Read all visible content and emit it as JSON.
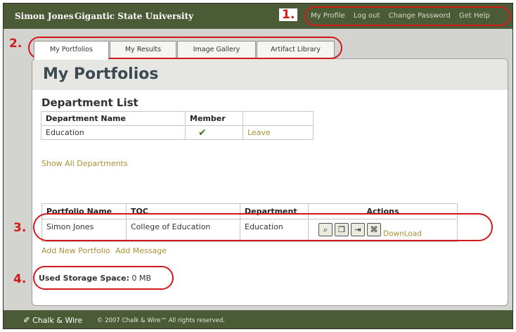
{
  "topbar": {
    "user_name": "Simon Jones",
    "university": "Gigantic State University",
    "links": [
      "My Profile",
      "Log out",
      "Change Password",
      "Get Help"
    ]
  },
  "tabs": [
    "My Portfolios",
    "My Results",
    "Image Gallery",
    "Artifact Library"
  ],
  "page_title": "My Portfolios",
  "departments": {
    "title": "Department List",
    "headers": [
      "Department Name",
      "Member",
      ""
    ],
    "rows": [
      {
        "name": "Education",
        "member": "✔",
        "action": "Leave"
      }
    ],
    "show_all": "Show All Departments"
  },
  "portfolios": {
    "headers": [
      "Portfolio Name",
      "TOC",
      "Department",
      "Actions"
    ],
    "rows": [
      {
        "name": "Simon Jones",
        "toc": "College of Education",
        "department": "Education",
        "icons": [
          "magnifier-icon",
          "copy-icon",
          "enter-icon",
          "grid-icon"
        ],
        "download": "DownLoad"
      }
    ],
    "add_portfolio": "Add New Portfolio",
    "add_message": "Add Message"
  },
  "storage": {
    "label": "Used Storage Space:",
    "value": "0 MB"
  },
  "annotations": [
    "1.",
    "2.",
    "3.",
    "4."
  ],
  "footer": {
    "logo": "Chalk & Wire",
    "copyright": "© 2007  Chalk & Wire™  All rights reserved."
  },
  "colors": {
    "bar": "#4b5b36",
    "link": "#a89234",
    "annotation": "#d01a1a",
    "check": "#3f7a22"
  }
}
